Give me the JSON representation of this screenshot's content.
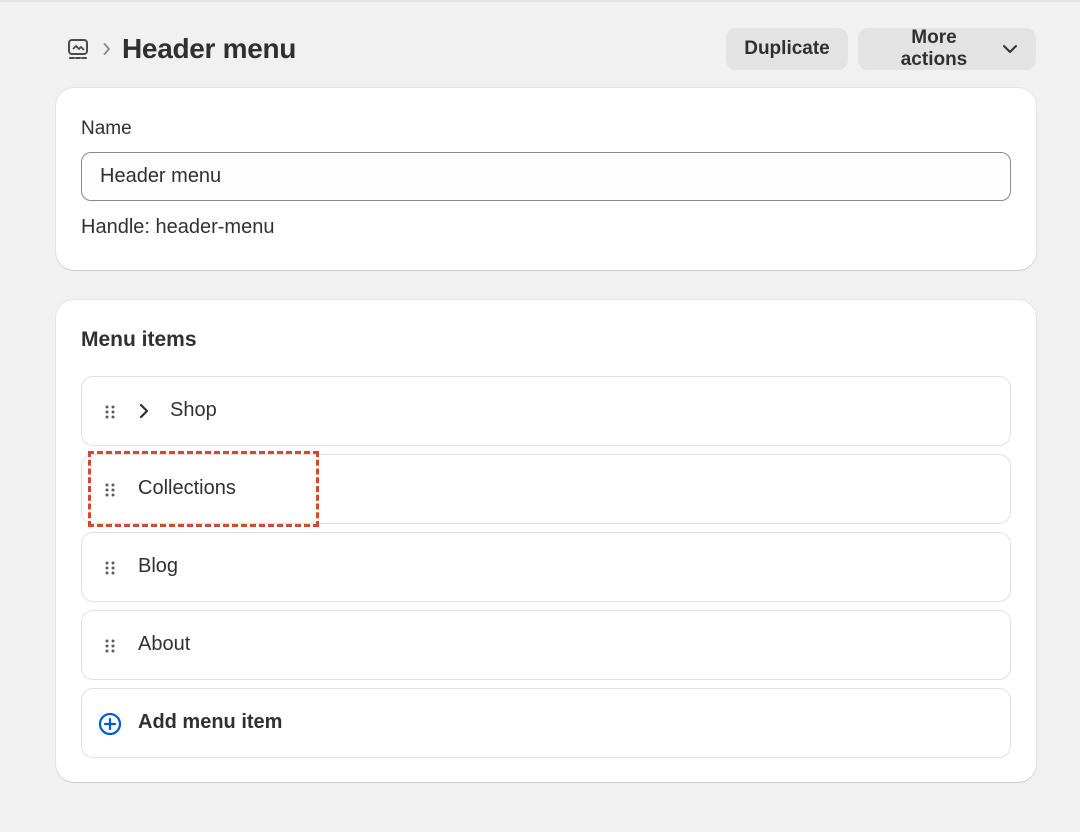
{
  "header": {
    "title": "Header menu",
    "duplicate_label": "Duplicate",
    "more_actions_label": "More actions",
    "nav_icon": "menu-navigation-icon",
    "breadcrumb_icon": "chevron-right-icon"
  },
  "name_section": {
    "label": "Name",
    "input_value": "Header menu",
    "handle_text": "Handle: header-menu"
  },
  "menu_section": {
    "title": "Menu items",
    "items": [
      {
        "label": "Shop",
        "expandable": true
      },
      {
        "label": "Collections",
        "expandable": false,
        "highlighted": true
      },
      {
        "label": "Blog",
        "expandable": false
      },
      {
        "label": "About",
        "expandable": false
      }
    ],
    "add_label": "Add menu item"
  },
  "colors": {
    "background": "#f1f1f1",
    "card": "#ffffff",
    "text": "#303030",
    "button_bg": "#e3e3e3",
    "add_icon": "#005bd3",
    "highlight": "#d24a2a"
  }
}
